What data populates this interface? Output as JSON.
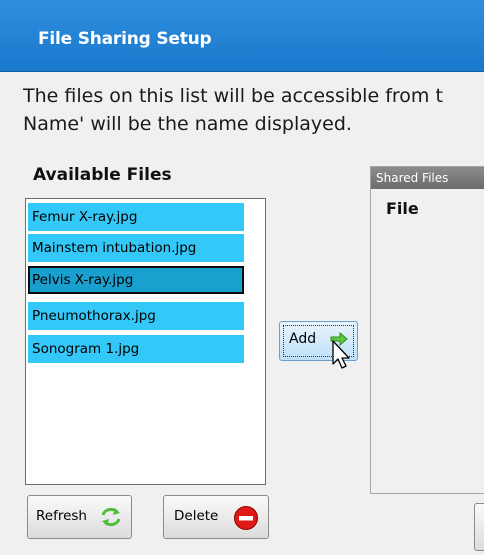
{
  "window": {
    "title": "File Sharing Setup",
    "description_line1": "The files on this list will be accessible from t",
    "description_line2": "Name' will be the name displayed."
  },
  "available": {
    "label": "Available Files",
    "items": [
      {
        "label": "Femur X-ray.jpg",
        "selected": false
      },
      {
        "label": "Mainstem intubation.jpg",
        "selected": false
      },
      {
        "label": "Pelvis X-ray.jpg",
        "selected": true
      },
      {
        "label": "Pneumothorax.jpg",
        "selected": false
      },
      {
        "label": "Sonogram 1.jpg",
        "selected": false
      }
    ]
  },
  "add_button": {
    "label": "Add",
    "icon": "green-right-arrow-icon"
  },
  "shared": {
    "panel_title": "Shared Files",
    "column_header": "File"
  },
  "buttons": {
    "refresh_label": "Refresh",
    "refresh_icon": "green-refresh-icon",
    "delete_label": "Delete",
    "delete_icon": "red-minus-circle-icon"
  },
  "colors": {
    "titlebar": "#1a78cc",
    "list_item": "#33c8f7",
    "list_item_selected": "#1aa0cf"
  }
}
